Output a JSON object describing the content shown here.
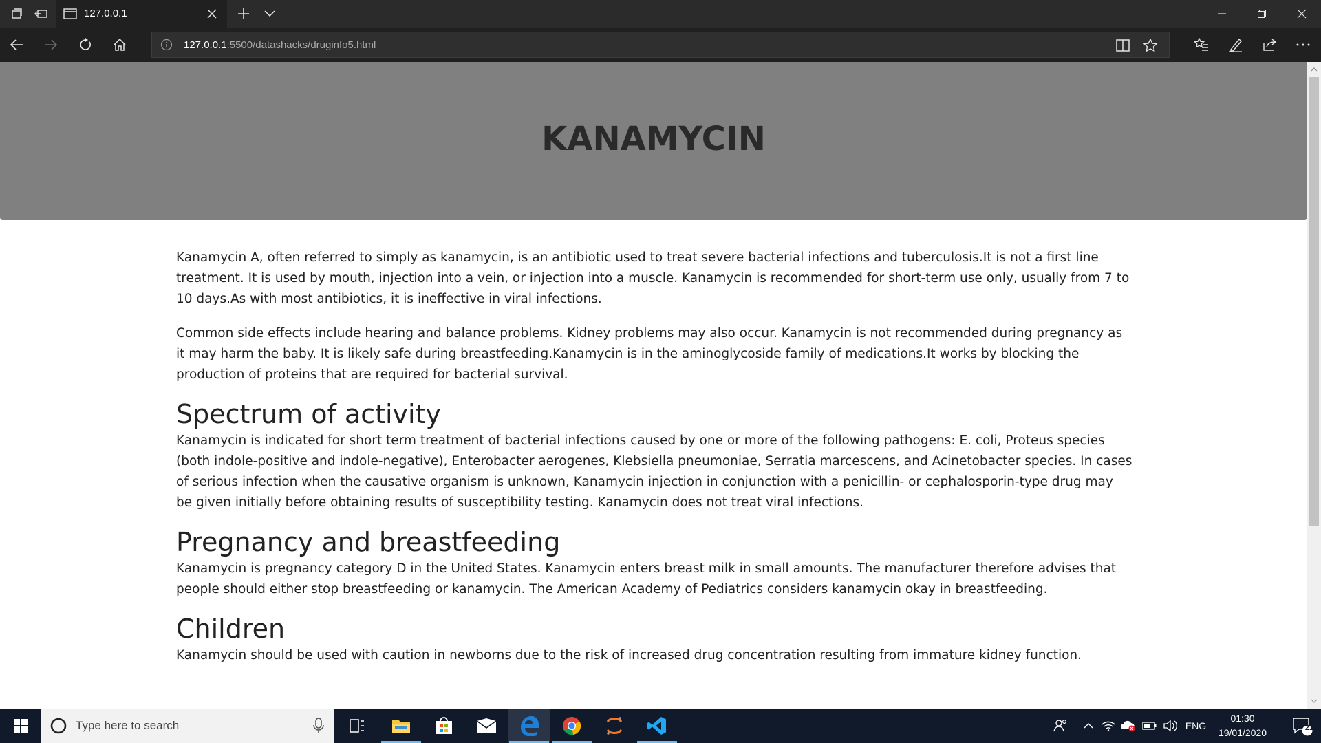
{
  "browser": {
    "tab_title": "127.0.0.1",
    "url_host": "127.0.0.1",
    "url_path": ":5500/datashacks/druginfo5.html"
  },
  "page": {
    "heading": "KANAMYCIN",
    "intro_paragraphs": [
      "Kanamycin A, often referred to simply as kanamycin, is an antibiotic used to treat severe bacterial infections and tuberculosis.It is not a first line treatment. It is used by mouth, injection into a vein, or injection into a muscle. Kanamycin is recommended for short-term use only, usually from 7 to 10 days.As with most antibiotics, it is ineffective in viral infections.",
      "Common side effects include hearing and balance problems. Kidney problems may also occur. Kanamycin is not recommended during pregnancy as it may harm the baby. It is likely safe during breastfeeding.Kanamycin is in the aminoglycoside family of medications.It works by blocking the production of proteins that are required for bacterial survival."
    ],
    "sections": [
      {
        "title": "Spectrum of activity",
        "body": "Kanamycin is indicated for short term treatment of bacterial infections caused by one or more of the following pathogens: E. coli, Proteus species (both indole-positive and indole-negative), Enterobacter aerogenes, Klebsiella pneumoniae, Serratia marcescens, and Acinetobacter species. In cases of serious infection when the causative organism is unknown, Kanamycin injection in conjunction with a penicillin- or cephalosporin-type drug may be given initially before obtaining results of susceptibility testing. Kanamycin does not treat viral infections."
      },
      {
        "title": "Pregnancy and breastfeeding",
        "body": "Kanamycin is pregnancy category D in the United States. Kanamycin enters breast milk in small amounts. The manufacturer therefore advises that people should either stop breastfeeding or kanamycin. The American Academy of Pediatrics considers kanamycin okay in breastfeeding."
      },
      {
        "title": "Children",
        "body": "Kanamycin should be used with caution in newborns due to the risk of increased drug concentration resulting from immature kidney function."
      }
    ]
  },
  "taskbar": {
    "search_placeholder": "Type here to search",
    "language": "ENG",
    "time": "01:30",
    "date": "19/01/2020",
    "notification_count": "21"
  },
  "colors": {
    "hero_background": "#808080",
    "chrome_dark": "#202020",
    "taskbar": "#101a2a",
    "edge_blue": "#1e7fd6",
    "vscode_blue": "#22a6f2"
  }
}
